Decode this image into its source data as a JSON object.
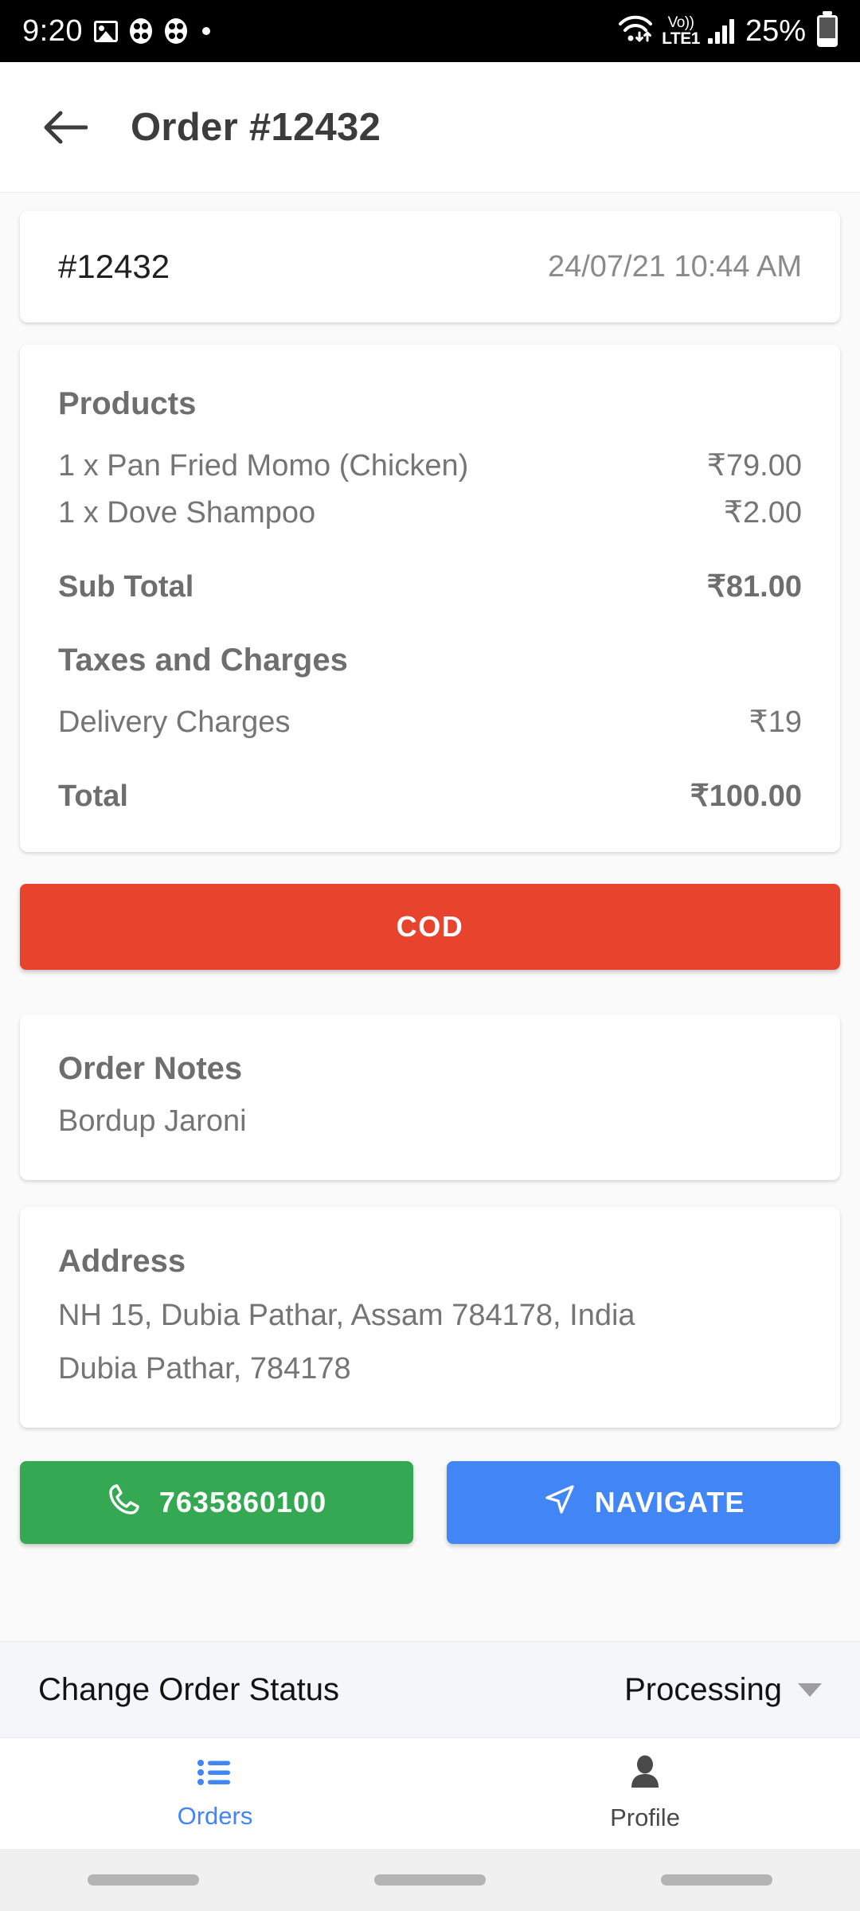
{
  "status_bar": {
    "time": "9:20",
    "battery_percent": "25%",
    "network_label_top": "Vo))",
    "network_label_bottom": "LTE1",
    "icons": [
      "photo-icon",
      "flower-app-icon",
      "flower-app-icon",
      "dot-icon",
      "wifi-icon",
      "volte-icon",
      "signal-bars-icon",
      "battery-icon"
    ]
  },
  "app_bar": {
    "back_icon": "back-arrow-icon",
    "title": "Order #12432"
  },
  "order_header": {
    "order_id": "#12432",
    "datetime": "24/07/21 10:44 AM"
  },
  "products_card": {
    "heading": "Products",
    "items": [
      {
        "name": "1 x Pan Fried Momo (Chicken)",
        "price": "₹79.00"
      },
      {
        "name": "1 x Dove Shampoo",
        "price": "₹2.00"
      }
    ],
    "sub_total_label": "Sub Total",
    "sub_total_value": "₹81.00",
    "taxes_heading": "Taxes and Charges",
    "charges": [
      {
        "name": "Delivery Charges",
        "price": "₹19"
      }
    ],
    "total_label": "Total",
    "total_value": "₹100.00"
  },
  "payment_button": {
    "label": "COD",
    "color": "#E8432C"
  },
  "order_notes": {
    "heading": "Order Notes",
    "value": "Bordup Jaroni"
  },
  "address": {
    "heading": "Address",
    "line1": "NH 15, Dubia Pathar, Assam 784178, India",
    "line2": "Dubia Pathar, 784178"
  },
  "actions": {
    "call_label": "7635860100",
    "call_color": "#34A853",
    "navigate_label": "NAVIGATE",
    "navigate_color": "#4285F4"
  },
  "status_strip": {
    "label": "Change Order Status",
    "value": "Processing"
  },
  "bottom_nav": {
    "items": [
      {
        "label": "Orders",
        "icon": "list-icon",
        "active": true
      },
      {
        "label": "Profile",
        "icon": "person-icon",
        "active": false
      }
    ],
    "active_color": "#4285F4"
  }
}
